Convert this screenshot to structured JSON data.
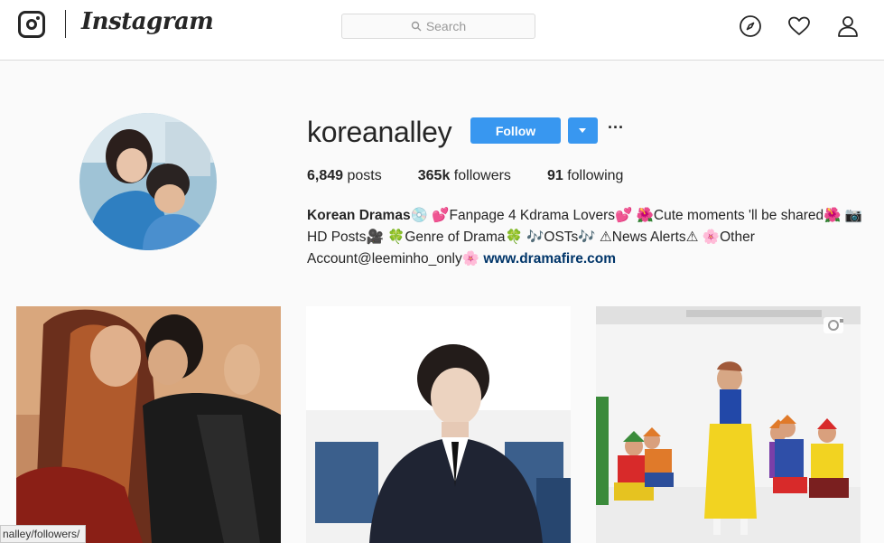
{
  "header": {
    "brand": "Instagram",
    "search_placeholder": "Search",
    "icons": [
      "instagram-logo-icon",
      "search-icon",
      "compass-icon",
      "heart-icon",
      "person-icon"
    ]
  },
  "profile": {
    "username": "koreanalley",
    "follow_label": "Follow",
    "more_label": "···",
    "stats": {
      "posts_count": "6,849",
      "posts_label": "posts",
      "followers_count": "365k",
      "followers_label": "followers",
      "following_count": "91",
      "following_label": "following"
    },
    "bio": {
      "name": "Korean Dramas",
      "line1_rest": "💿 💕Fanpage 4 Kdrama Lovers💕 🌺Cute moments 'll be shared🌺 📷",
      "line2": "HD Posts🎥 🍀Genre of Drama🍀 🎶OSTs🎶 ⚠News Alerts⚠ 🌸Other",
      "line3_text": "Account@leeminho_only🌸 ",
      "website": "www.dramafire.com"
    }
  },
  "grid": {
    "posts": [
      {
        "name": "post-couple-photo"
      },
      {
        "name": "post-man-in-suit"
      },
      {
        "name": "post-snow-white-dance"
      }
    ],
    "video_icon": "video-camera-icon"
  },
  "status_bar": {
    "url": "nalley/followers/"
  },
  "colors": {
    "accent": "#3897f0",
    "link": "#003569",
    "border": "#dbdbdb",
    "background": "#fafafa"
  }
}
